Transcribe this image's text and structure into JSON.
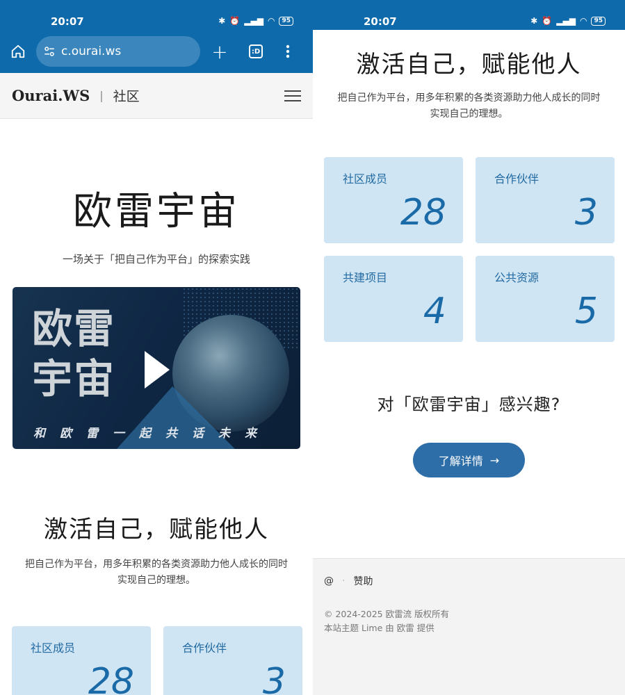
{
  "status": {
    "time": "20:07",
    "battery": "95"
  },
  "browser": {
    "url": "c.ourai.ws",
    "tabs_label": ":D"
  },
  "site": {
    "logo": "Ourai.WS",
    "section": "社区"
  },
  "hero": {
    "title": "欧雷宇宙",
    "subtitle": "一场关于「把自己作为平台」的探索实践"
  },
  "video": {
    "title": "欧雷宇宙",
    "slogan": "和欧雷一起共话未来"
  },
  "empower": {
    "title": "激活自己，赋能他人",
    "desc_line1": "把自己作为平台，用多年积累的各类资源助力他人成长的同时",
    "desc_line2": "实现自己的理想。"
  },
  "stats": [
    {
      "label": "社区成员",
      "value": "28"
    },
    {
      "label": "合作伙伴",
      "value": "3"
    },
    {
      "label": "共建项目",
      "value": "4"
    },
    {
      "label": "公共资源",
      "value": "5"
    }
  ],
  "cta": {
    "question": "对「欧雷宇宙」感兴趣?",
    "button": "了解详情",
    "arrow": "→"
  },
  "footer": {
    "at": "@",
    "dot": "·",
    "sponsor": "赞助",
    "copyright": "© 2024-2025 欧雷流 版权所有",
    "theme": "本站主题 Lime 由 欧雷 提供"
  },
  "colors": {
    "brand": "#0e6aaa",
    "card_bg": "#cfe5f3",
    "accent": "#2d6ea8"
  }
}
